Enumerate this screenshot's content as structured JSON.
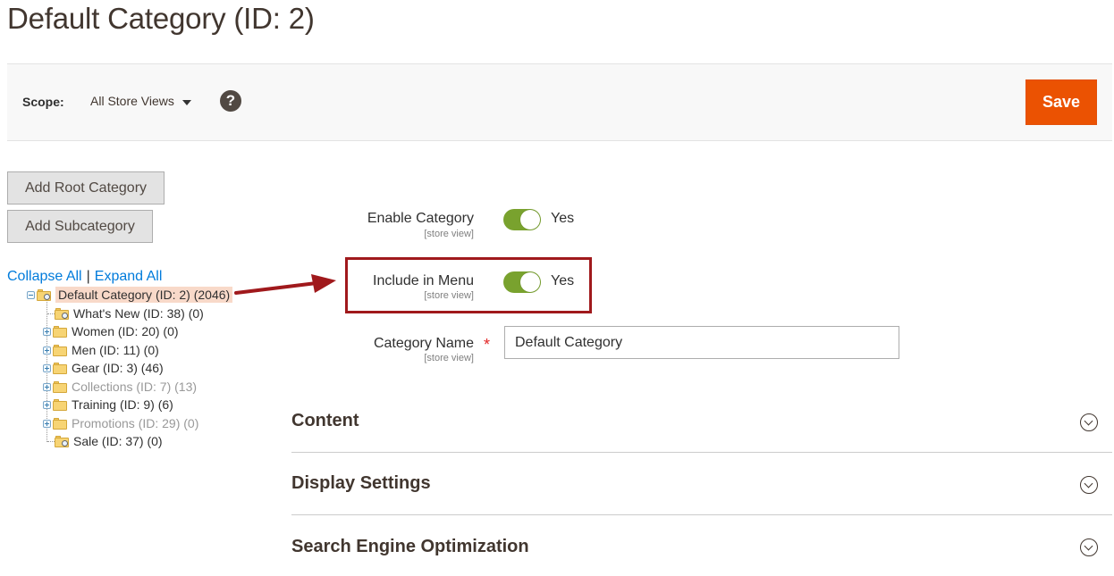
{
  "page": {
    "title": "Default Category (ID: 2)"
  },
  "scope": {
    "label": "Scope:",
    "selected": "All Store Views",
    "help_icon": "question-mark-icon",
    "help_glyph": "?"
  },
  "toolbar": {
    "save_label": "Save"
  },
  "buttons": {
    "add_root": "Add Root Category",
    "add_sub": "Add Subcategory"
  },
  "tree_links": {
    "collapse_all": "Collapse All",
    "separator": "|",
    "expand_all": "Expand All"
  },
  "tree": {
    "root": {
      "label": "Default Category (ID: 2) (2046)"
    },
    "children": [
      {
        "label": "What's New (ID: 38) (0)",
        "expandable": false,
        "muted": false
      },
      {
        "label": "Women (ID: 20) (0)",
        "expandable": true,
        "muted": false
      },
      {
        "label": "Men (ID: 11) (0)",
        "expandable": true,
        "muted": false
      },
      {
        "label": "Gear (ID: 3) (46)",
        "expandable": true,
        "muted": false
      },
      {
        "label": "Collections (ID: 7) (13)",
        "expandable": true,
        "muted": true
      },
      {
        "label": "Training (ID: 9) (6)",
        "expandable": true,
        "muted": false
      },
      {
        "label": "Promotions (ID: 29) (0)",
        "expandable": true,
        "muted": true
      },
      {
        "label": "Sale (ID: 37) (0)",
        "expandable": false,
        "muted": false
      }
    ]
  },
  "form": {
    "enable_category": {
      "label": "Enable Category",
      "scope": "[store view]",
      "value": "Yes"
    },
    "include_in_menu": {
      "label": "Include in Menu",
      "scope": "[store view]",
      "value": "Yes"
    },
    "category_name": {
      "label": "Category Name",
      "scope": "[store view]",
      "required_mark": "*",
      "value": "Default Category"
    }
  },
  "sections": [
    {
      "title": "Content"
    },
    {
      "title": "Display Settings"
    },
    {
      "title": "Search Engine Optimization"
    }
  ],
  "colors": {
    "accent": "#eb5202",
    "toggle_on": "#79a22e",
    "link": "#007bdb",
    "highlight": "#a0191c",
    "root_selected_bg": "#f8d9c9"
  }
}
